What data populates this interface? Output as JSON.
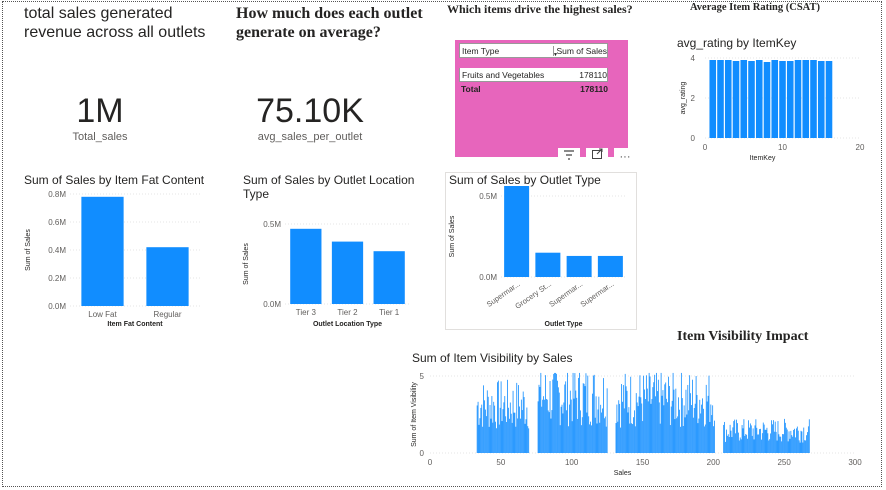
{
  "headings": {
    "total_sales_q": "total sales generated revenue across all outlets",
    "avg_outlet_q": "How much does each outlet generate on average?",
    "items_q": "Which items drive the highest sales?",
    "rating_q": "Average Item Rating (CSAT)",
    "visibility_q": "Item Visibility Impact"
  },
  "kpis": {
    "total_sales_value": "1M",
    "total_sales_label": "Total_sales",
    "avg_sales_value": "75.10K",
    "avg_sales_label": "avg_sales_per_outlet"
  },
  "table": {
    "col1": "Item Type",
    "col2": "Sum of Sales",
    "sort_icon": "sort-desc-icon",
    "rows": [
      {
        "type": "Fruits and Vegetables",
        "sales": "178110"
      }
    ],
    "total_label": "Total",
    "total_value": "178110",
    "toolbar_icons": [
      "filter-icon",
      "focus-mode-icon",
      "more-options-icon"
    ]
  },
  "colors": {
    "bar": "#118dff",
    "highlight_bg": "#e765bc"
  },
  "chart_data": [
    {
      "type": "bar",
      "title": "avg_rating by ItemKey",
      "xlabel": "ItemKey",
      "ylabel": "avg_rating",
      "x": [
        1,
        2,
        3,
        4,
        5,
        6,
        7,
        8,
        9,
        10,
        11,
        12,
        13,
        14,
        15,
        16
      ],
      "values": [
        3.9,
        3.9,
        3.9,
        3.85,
        3.9,
        3.85,
        3.9,
        3.8,
        3.9,
        3.85,
        3.85,
        3.9,
        3.9,
        3.9,
        3.85,
        3.85
      ],
      "xlim": [
        0,
        20
      ],
      "ylim": [
        0,
        4
      ],
      "xticks": [
        "0",
        "10",
        "20"
      ],
      "yticks": [
        "0",
        "2",
        "4"
      ]
    },
    {
      "type": "bar",
      "title": "Sum of Sales by Item Fat Content",
      "xlabel": "Item Fat Content",
      "ylabel": "Sum of Sales",
      "categories": [
        "Low Fat",
        "Regular"
      ],
      "values": [
        0.78,
        0.42
      ],
      "ylim": [
        0,
        0.8
      ],
      "yticks": [
        "0.0M",
        "0.2M",
        "0.4M",
        "0.6M",
        "0.8M"
      ]
    },
    {
      "type": "bar",
      "title": "Sum of Sales by Outlet Location Type",
      "xlabel": "Outlet Location Type",
      "ylabel": "Sum of Sales",
      "categories": [
        "Tier 3",
        "Tier 2",
        "Tier 1"
      ],
      "values": [
        0.47,
        0.39,
        0.33
      ],
      "ylim": [
        0,
        0.5
      ],
      "yticks": [
        "0.0M",
        "0.5M"
      ]
    },
    {
      "type": "bar",
      "title": "Sum of Sales by Outlet Type",
      "xlabel": "Outlet Type",
      "ylabel": "Sum of Sales",
      "categories": [
        "Supermar...",
        "Grocery St...",
        "Supermar...",
        "Supermar..."
      ],
      "values": [
        0.78,
        0.15,
        0.13,
        0.13
      ],
      "ylim": [
        0,
        0.5
      ],
      "yticks": [
        "0.0M",
        "0.5M"
      ]
    },
    {
      "type": "bar",
      "title": "Sum of Item Visibility by Sales",
      "xlabel": "Sales",
      "ylabel": "Sum of Item Visibility",
      "xlim": [
        0,
        300
      ],
      "ylim": [
        0,
        5
      ],
      "xticks": [
        "0",
        "50",
        "100",
        "150",
        "200",
        "250",
        "300"
      ],
      "yticks": [
        "0",
        "5"
      ],
      "segments": [
        {
          "from": 33,
          "to": 70,
          "typical": 3.2
        },
        {
          "from": 76,
          "to": 125,
          "typical": 3.8
        },
        {
          "from": 131,
          "to": 201,
          "typical": 3.6
        },
        {
          "from": 207,
          "to": 268,
          "typical": 1.5
        }
      ]
    }
  ]
}
